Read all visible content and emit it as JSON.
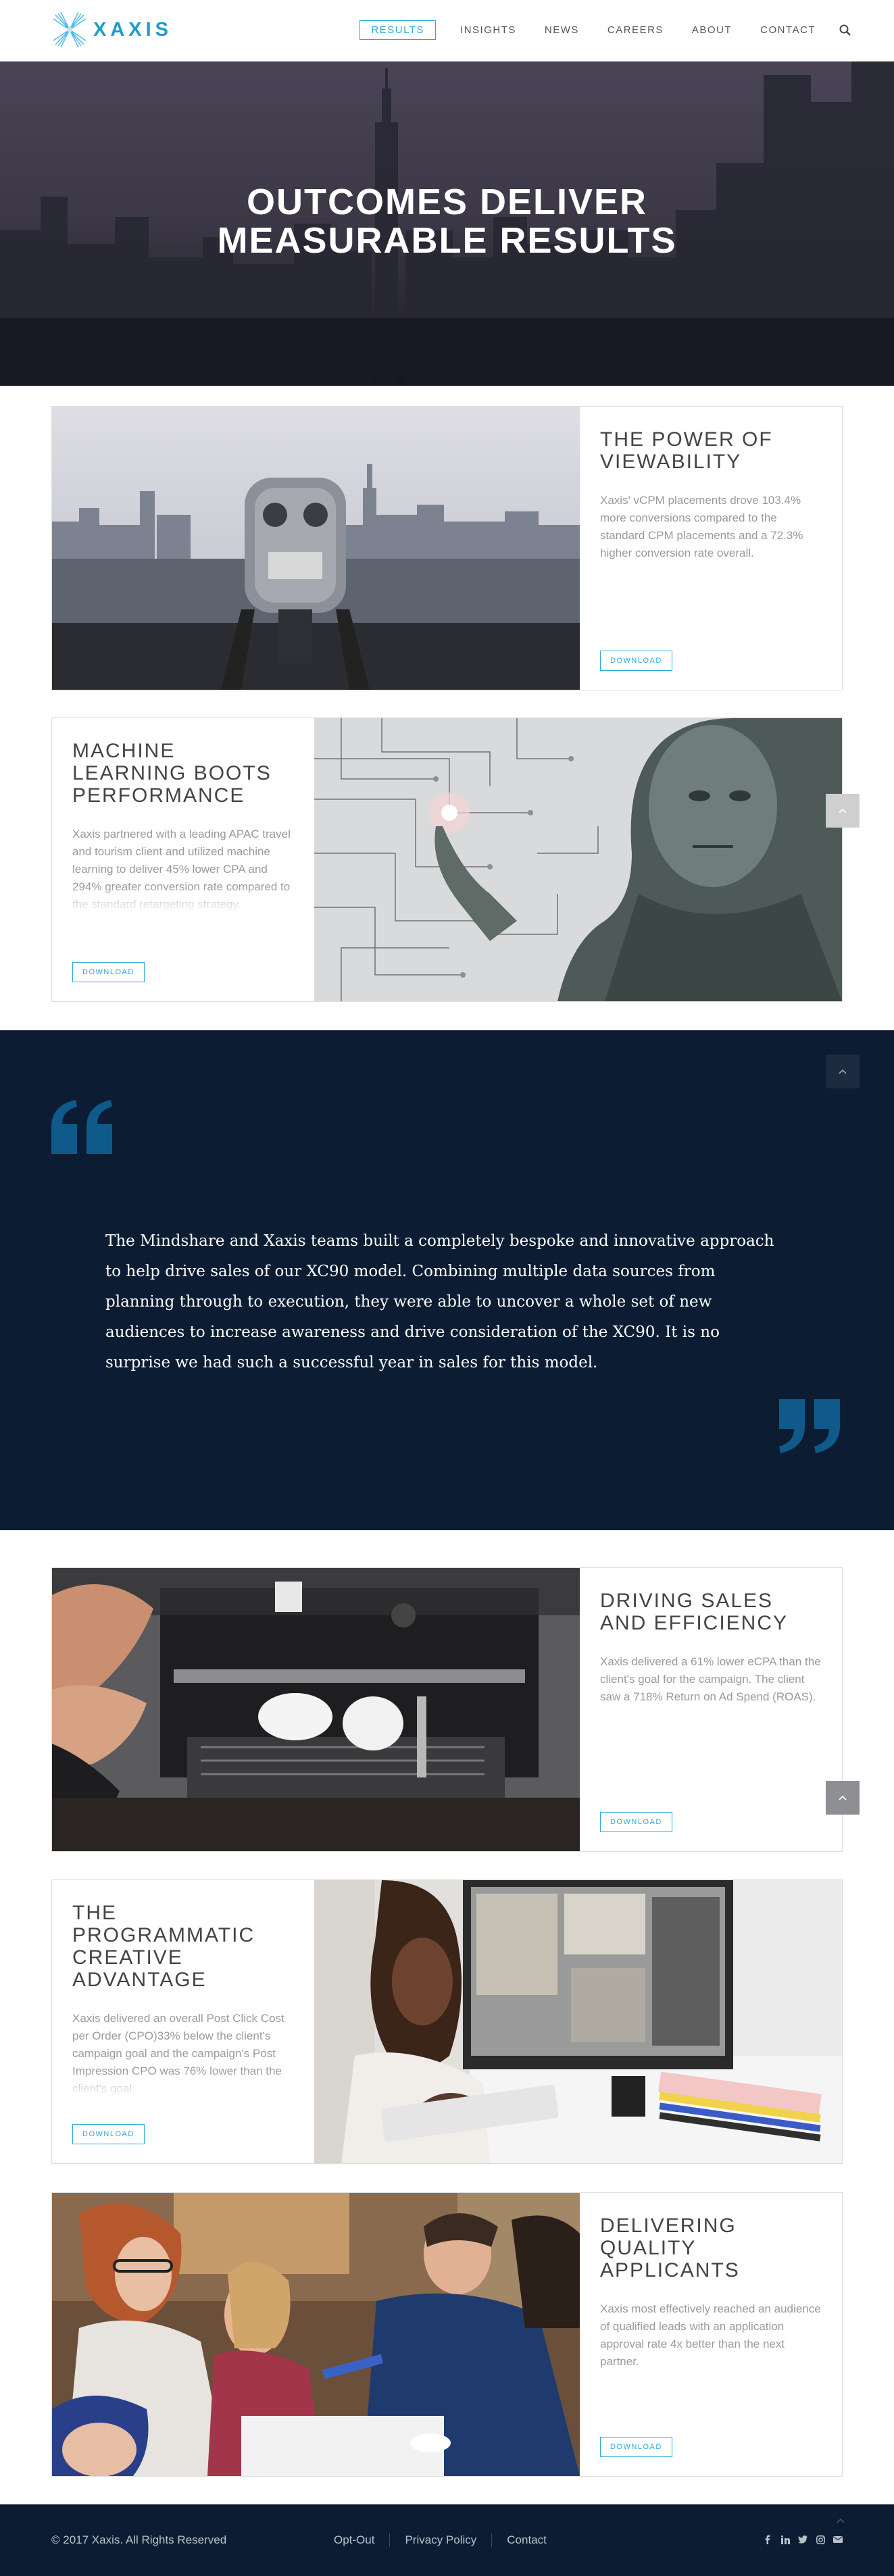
{
  "brand": {
    "name": "XAXIS",
    "accent": "#2aa8d8",
    "dark_navy": "#0c1d33"
  },
  "nav": {
    "items": [
      "RESULTS",
      "INSIGHTS",
      "NEWS",
      "CAREERS",
      "ABOUT",
      "CONTACT"
    ],
    "active": "RESULTS",
    "search_icon": "search-icon"
  },
  "hero": {
    "line1": "OUTCOMES DELIVER",
    "line2": "MEASURABLE RESULTS"
  },
  "cards": [
    {
      "title": "THE POWER OF VIEWABILITY",
      "description": "Xaxis' vCPM placements drove 103.4% more conversions compared to the standard CPM placements and a 72.3% higher conversion rate overall.",
      "button": "DOWNLOAD"
    },
    {
      "title": "MACHINE LEARNING BOOTS PERFORMANCE",
      "description": "Xaxis partnered with a leading APAC travel and tourism client and utilized machine learning to deliver 45% lower CPA and 294% greater conversion rate compared to the standard retargeting strategy.",
      "button": "DOWNLOAD"
    },
    {
      "title": "DRIVING SALES AND EFFICIENCY",
      "description": "Xaxis delivered a 61% lower eCPA than the client's goal for the campaign. The client saw a 718% Return on Ad Spend (ROAS).",
      "button": "DOWNLOAD"
    },
    {
      "title": "THE PROGRAMMATIC CREATIVE ADVANTAGE",
      "description": "Xaxis delivered an overall Post Click Cost per Order (CPO)33% below the client's campaign goal and the campaign's Post Impression CPO was 76% lower than the client's goal.",
      "button": "DOWNLOAD"
    },
    {
      "title": "DELIVERING QUALITY APPLICANTS",
      "description": "Xaxis most effectively reached an audience of qualified leads with an application approval rate 4x better than the next partner.",
      "button": "DOWNLOAD"
    }
  ],
  "quote": {
    "text": "The Mindshare and Xaxis teams built a completely bespoke and innovative approach to help drive sales of our XC90 model. Combining multiple data sources from planning through to execution, they were able to uncover a whole set of new audiences to increase awareness and drive consideration of the XC90. It is no surprise we had such a successful year in sales for this model."
  },
  "footer": {
    "copyright": "© 2017 Xaxis. All Rights Reserved",
    "links": [
      "Opt-Out",
      "Privacy Policy",
      "Contact"
    ],
    "social_icons": [
      "facebook-icon",
      "linkedin-icon",
      "twitter-icon",
      "instagram-icon",
      "email-icon"
    ]
  }
}
